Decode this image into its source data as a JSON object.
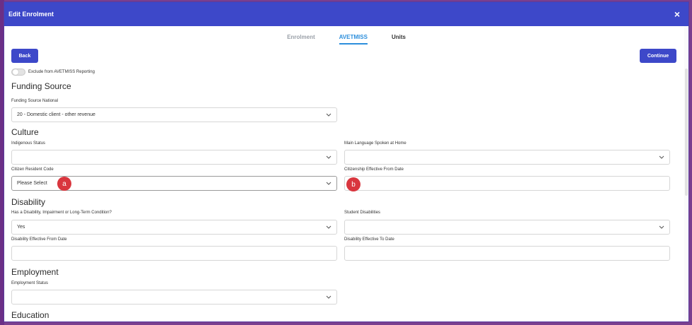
{
  "modal": {
    "title": "Edit Enrolment",
    "close": "×"
  },
  "tabs": [
    {
      "label": "Enrolment"
    },
    {
      "label": "AVETMISS"
    },
    {
      "label": "Units"
    }
  ],
  "buttons": {
    "back": "Back",
    "continue": "Continue"
  },
  "toggle": {
    "label": "Exclude from AVETMISS Reporting",
    "checked": false
  },
  "sections": {
    "funding": "Funding Source",
    "culture": "Culture",
    "disability": "Disability",
    "employment": "Employment",
    "education": "Education"
  },
  "fields": {
    "funding_source_national": {
      "label": "Funding Source National",
      "value": "20 - Domestic client - other revenue"
    },
    "indigenous_status": {
      "label": "Indigenous Status",
      "value": ""
    },
    "main_language": {
      "label": "Main Language Spoken at Home",
      "value": ""
    },
    "citizen_resident_code": {
      "label": "Citizen Resident Code",
      "value": "Please Select"
    },
    "citizenship_effective_from": {
      "label": "Citizenship Effective From Date",
      "value": ""
    },
    "has_disability": {
      "label": "Has a Disability, Impairment or Long-Term Condition?",
      "value": "Yes"
    },
    "student_disabilities": {
      "label": "Student Disabilities",
      "value": ""
    },
    "disability_from": {
      "label": "Disability Effective From Date",
      "value": ""
    },
    "disability_to": {
      "label": "Disability Effective To Date",
      "value": ""
    },
    "employment_status": {
      "label": "Employment Status",
      "value": ""
    }
  },
  "annotations": {
    "a": "a",
    "b": "b"
  },
  "colors": {
    "header": "#3d48c9",
    "active_tab": "#2d8fdc",
    "badge": "#d9363e"
  }
}
